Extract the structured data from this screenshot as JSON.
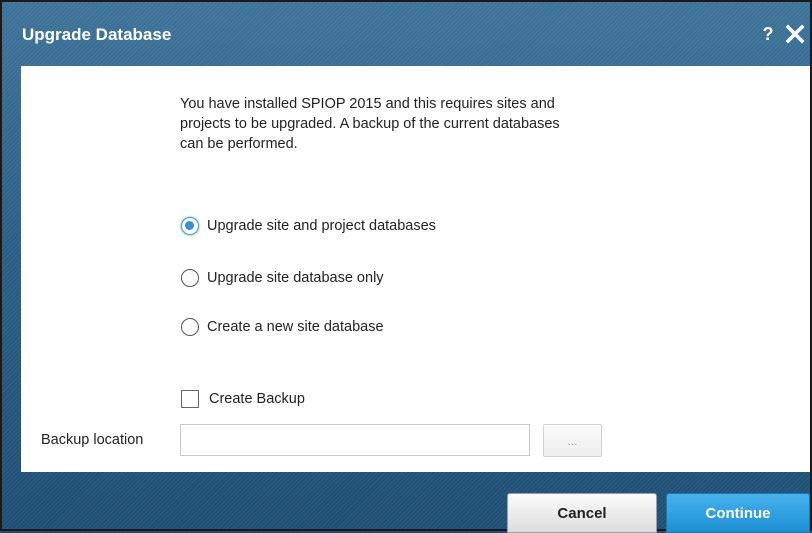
{
  "dialog": {
    "title": "Upgrade Database",
    "help_label": "?"
  },
  "message": "You have installed SPIOP 2015 and this requires sites and\nprojects to be upgraded. A backup of the current databases\ncan be performed.",
  "options": [
    {
      "label": "Upgrade site and project databases",
      "selected": true
    },
    {
      "label": "Upgrade site database only",
      "selected": false
    },
    {
      "label": "Create a new site database",
      "selected": false
    }
  ],
  "backup": {
    "checkbox_label": "Create Backup",
    "checked": false,
    "location_label": "Backup location",
    "location_value": "",
    "browse_label": "..."
  },
  "buttons": {
    "cancel": "Cancel",
    "continue": "Continue"
  },
  "colors": {
    "titlebar": "#2b5f86",
    "accent": "#1e8fd4"
  }
}
